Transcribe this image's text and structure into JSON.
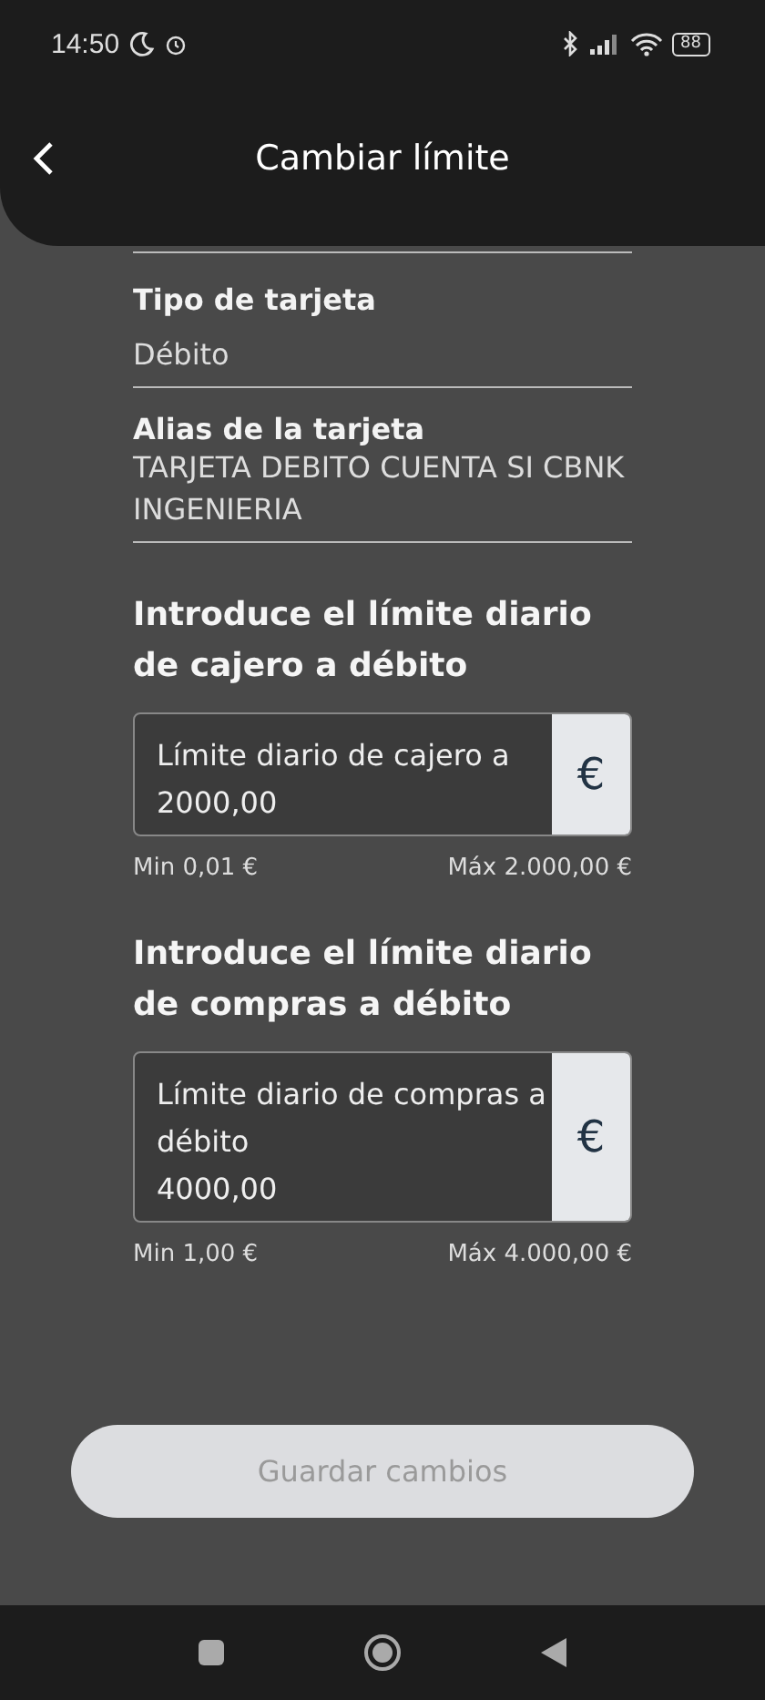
{
  "status_bar": {
    "time": "14:50",
    "battery": "88"
  },
  "header": {
    "title": "Cambiar límite"
  },
  "card_info": [
    {
      "label": "Tipo de tarjeta",
      "value": "Débito"
    },
    {
      "label": "Alias de la tarjeta",
      "value": "TARJETA DEBITO CUENTA SI CBNK INGENIERIA"
    }
  ],
  "limits": [
    {
      "heading": "Introduce el límite diario de cajero a débito",
      "field_label": "Límite diario de cajero a",
      "value": "2000,00",
      "currency": "€",
      "min": "Min 0,01 €",
      "max": "Máx 2.000,00 €"
    },
    {
      "heading": "Introduce el límite diario de compras a débito",
      "field_label": "Límite diario de compras a débito",
      "value": "4000,00",
      "currency": "€",
      "min": "Min 1,00 €",
      "max": "Máx 4.000,00 €"
    }
  ],
  "save_button": {
    "label": "Guardar cambios",
    "disabled": true
  }
}
